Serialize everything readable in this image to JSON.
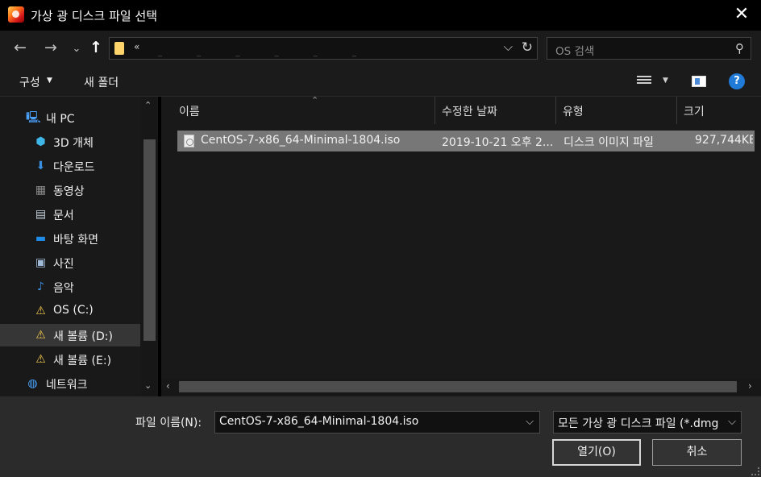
{
  "window": {
    "title": "가상 광 디스크 파일 선택",
    "close_glyph": "✕"
  },
  "address": {
    "breadcrumb_sep": "«",
    "path_text": "_ _ _ _ _ _",
    "dropdown_glyph": "⌵",
    "refresh_glyph": "↻"
  },
  "search": {
    "placeholder": "OS 검색",
    "icon_glyph": "⚲"
  },
  "nav_buttons": {
    "back": "←",
    "forward": "→",
    "history": "⌄",
    "up": "↑"
  },
  "toolbar": {
    "organize_label": "구성",
    "organize_caret": "▼",
    "new_folder_label": "새 폴더",
    "view_caret": "▼",
    "help_glyph": "?"
  },
  "sidebar": {
    "items": [
      {
        "label": "내 PC",
        "icon": "pc-icon",
        "glyph": "🖳",
        "color": "#4aa3ff"
      },
      {
        "label": "3D 개체",
        "icon": "cube-icon",
        "glyph": "⬢",
        "color": "#3fb6e8"
      },
      {
        "label": "다운로드",
        "icon": "download-icon",
        "glyph": "⬇",
        "color": "#3b8fe0"
      },
      {
        "label": "동영상",
        "icon": "video-icon",
        "glyph": "▦",
        "color": "#8b8b8b"
      },
      {
        "label": "문서",
        "icon": "document-icon",
        "glyph": "▤",
        "color": "#c8d2dc"
      },
      {
        "label": "바탕 화면",
        "icon": "desktop-icon",
        "glyph": "▬",
        "color": "#1f8ce8"
      },
      {
        "label": "사진",
        "icon": "picture-icon",
        "glyph": "▣",
        "color": "#9fb9d6"
      },
      {
        "label": "음악",
        "icon": "music-icon",
        "glyph": "♪",
        "color": "#3b8fe0"
      },
      {
        "label": "OS (C:)",
        "icon": "drive-warning-icon",
        "glyph": "⚠",
        "color": "#f2c94c"
      },
      {
        "label": "새 볼륨 (D:)",
        "icon": "drive-warning-icon",
        "glyph": "⚠",
        "color": "#f2c94c"
      },
      {
        "label": "새 볼륨 (E:)",
        "icon": "drive-warning-icon",
        "glyph": "⚠",
        "color": "#f2c94c"
      },
      {
        "label": "네트워크",
        "icon": "network-icon",
        "glyph": "◍",
        "color": "#4aa3ff"
      }
    ],
    "selected": "새 볼륨 (D:)",
    "scroll_up": "⌃",
    "scroll_down": "⌄"
  },
  "file_list": {
    "columns": [
      "이름",
      "수정한 날짜",
      "유형",
      "크기"
    ],
    "sort_glyph": "⌃",
    "rows": [
      {
        "name": "CentOS-7-x86_64-Minimal-1804.iso",
        "modified": "2019-10-21 오후 2...",
        "type": "디스크 이미지 파일",
        "size": "927,744KB"
      }
    ],
    "hscroll_left": "‹",
    "hscroll_right": "›"
  },
  "footer": {
    "filename_label": "파일 이름(N):",
    "filename_value": "CentOS-7-x86_64-Minimal-1804.iso",
    "filter_value": "모든 가상 광 디스크 파일 (*.dmg",
    "dropdown_glyph": "⌵",
    "open_label": "열기(O)",
    "cancel_label": "취소"
  },
  "colors": {
    "accent": "#1f7ad8",
    "selected_row": "#777777",
    "selected_nav": "#363636",
    "background": "#191919"
  }
}
